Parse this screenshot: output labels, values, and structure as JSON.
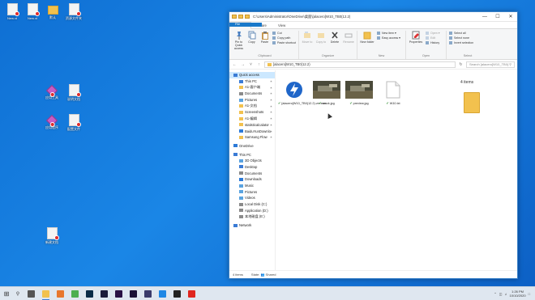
{
  "desktop": {
    "icons": [
      {
        "label": "New.xt",
        "kind": "doc"
      },
      {
        "label": "New.xt",
        "kind": "doc"
      },
      {
        "label": "默认",
        "kind": "folder"
      },
      {
        "label": "资源文件夹",
        "kind": "doc"
      },
      {
        "label": "应用工具",
        "kind": "app"
      },
      {
        "label": "说明文档",
        "kind": "doc"
      },
      {
        "label": "应用程序",
        "kind": "app"
      },
      {
        "label": "配置文件",
        "kind": "doc"
      },
      {
        "label": "新建文档",
        "kind": "doc"
      }
    ]
  },
  "window": {
    "title": "C:\\Users\\Administrator\\OneDrive\\桌面\\[alacero]W10_TB0(12.2)",
    "buttons": {
      "minimize": "—",
      "maximize": "☐",
      "close": "✕"
    }
  },
  "ribbon": {
    "tabs": [
      "File",
      "Home",
      "Share",
      "View"
    ],
    "active_tab": "Home",
    "clipboard": {
      "name": "Clipboard",
      "pin": "Pin to Quick access",
      "copy": "Copy",
      "paste": "Paste",
      "cut": "Cut",
      "copy_path": "Copy path",
      "paste_shortcut": "Paste shortcut"
    },
    "organize": {
      "name": "Organize",
      "move_to": "Move to",
      "copy_to": "Copy to",
      "delete": "Delete",
      "rename": "Rename"
    },
    "new": {
      "name": "New",
      "new_folder": "New folder",
      "new_item": "New item ▾",
      "easy_access": "Easy access ▾"
    },
    "open": {
      "name": "Open",
      "properties": "Properties",
      "open": "Open ▾",
      "edit": "Edit",
      "history": "History"
    },
    "select": {
      "name": "Select",
      "select_all": "Select all",
      "select_none": "Select none",
      "invert": "Invert selection"
    }
  },
  "address": {
    "path": "[alacero]W10_TB0(12.2)",
    "search_placeholder": "Search [alacero]W10_TB0(12.2)"
  },
  "nav": {
    "items": [
      {
        "label": "Quick access",
        "icon": "star-icon",
        "color": "#3a7bd5",
        "level": 0,
        "selected": true
      },
      {
        "label": "This PC",
        "icon": "pc-icon",
        "color": "#3a7bd5",
        "level": 1,
        "pin": true
      },
      {
        "label": "A1-客户端",
        "icon": "folder-icon",
        "color": "#f2c14e",
        "level": 1,
        "pin": true
      },
      {
        "label": "Documents",
        "icon": "documents-icon",
        "color": "#8a8a8a",
        "level": 1,
        "pin": true
      },
      {
        "label": "Pictures",
        "icon": "pictures-icon",
        "color": "#5aa3e0",
        "level": 1,
        "pin": true
      },
      {
        "label": "A1-文档",
        "icon": "folder-icon",
        "color": "#f2c14e",
        "level": 1,
        "pin": true
      },
      {
        "label": "Screenshots",
        "icon": "folder-icon",
        "color": "#f2c14e",
        "level": 1,
        "pin": true
      },
      {
        "label": "A1-编辑",
        "icon": "folder-icon",
        "color": "#f2c14e",
        "level": 1,
        "pin": true
      },
      {
        "label": "statisticalcalator",
        "icon": "folder-icon",
        "color": "#f2c14e",
        "level": 1,
        "pin": true
      },
      {
        "label": "BaiduYunDownlo",
        "icon": "download-icon",
        "color": "#2c7ad8",
        "level": 1,
        "pin": true
      },
      {
        "label": "Samsung Flow",
        "icon": "folder-icon",
        "color": "#f2c14e",
        "level": 1,
        "pin": true
      },
      {
        "label": "OneDrive",
        "icon": "cloud-icon",
        "color": "#2c7ad8",
        "level": 0,
        "gap": true
      },
      {
        "label": "This PC",
        "icon": "pc-icon",
        "color": "#3a7bd5",
        "level": 0,
        "gap": true
      },
      {
        "label": "3D Objects",
        "icon": "cube-icon",
        "color": "#5aa3e0",
        "level": 1
      },
      {
        "label": "Desktop",
        "icon": "desktop-icon",
        "color": "#3a7bd5",
        "level": 1
      },
      {
        "label": "Documents",
        "icon": "documents-icon",
        "color": "#8a8a8a",
        "level": 1
      },
      {
        "label": "Downloads",
        "icon": "download-icon",
        "color": "#2c7ad8",
        "level": 1
      },
      {
        "label": "Music",
        "icon": "music-icon",
        "color": "#5aa3e0",
        "level": 1
      },
      {
        "label": "Pictures",
        "icon": "pictures-icon",
        "color": "#5aa3e0",
        "level": 1
      },
      {
        "label": "Videos",
        "icon": "video-icon",
        "color": "#5aa3e0",
        "level": 1
      },
      {
        "label": "Local Disk (C:)",
        "icon": "drive-icon",
        "color": "#8a8a8a",
        "level": 1
      },
      {
        "label": "Application (D:)",
        "icon": "drive-icon",
        "color": "#8a8a8a",
        "level": 1
      },
      {
        "label": "本地磁盘 (E:)",
        "icon": "drive-icon",
        "color": "#8a8a8a",
        "level": 1
      },
      {
        "label": "Network",
        "icon": "network-icon",
        "color": "#3a7bd5",
        "level": 0,
        "gap": true
      }
    ]
  },
  "files": [
    {
      "name": "[alacero]W10_TB0(12.2).ver.exe",
      "kind": "exe",
      "synced": true
    },
    {
      "name": "crack.jpg",
      "kind": "img",
      "synced": true
    },
    {
      "name": "preview.jpg",
      "kind": "img",
      "synced": true
    },
    {
      "name": "W10.txt",
      "kind": "txt",
      "synced": true
    }
  ],
  "preview": {
    "count_text": "4 items"
  },
  "status": {
    "items": "4 items",
    "state": "State: 👥 Shared"
  },
  "taskbar": {
    "apps": [
      {
        "name": "task-view",
        "color": "#555"
      },
      {
        "name": "file-explorer",
        "color": "#f2c14e",
        "active": true
      },
      {
        "name": "firefox",
        "color": "#e8772e"
      },
      {
        "name": "chrome",
        "color": "#4caf50"
      },
      {
        "name": "photoshop",
        "color": "#0a2b47"
      },
      {
        "name": "app-dark",
        "color": "#1b1b3a"
      },
      {
        "name": "premiere",
        "color": "#2a1144"
      },
      {
        "name": "after-effects",
        "color": "#1a1035"
      },
      {
        "name": "app-grid",
        "color": "#3b3b6b"
      },
      {
        "name": "vscode",
        "color": "#1e88e5"
      },
      {
        "name": "terminal",
        "color": "#222"
      },
      {
        "name": "opera",
        "color": "#e0261f"
      }
    ],
    "time": "1:26 PM",
    "date": "10/10/2020"
  }
}
